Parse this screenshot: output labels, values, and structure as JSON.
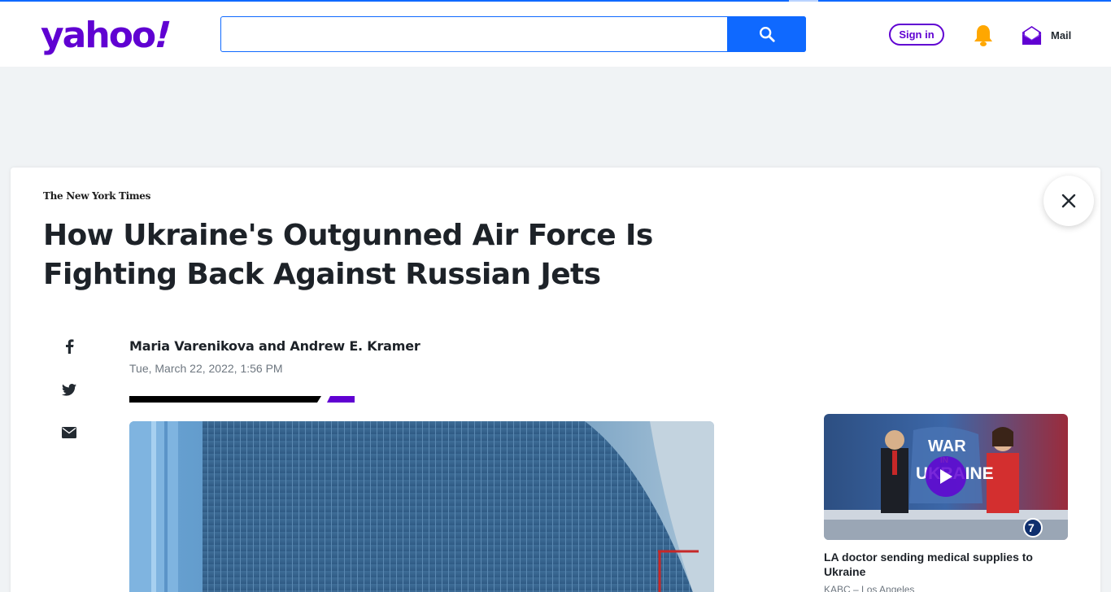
{
  "header": {
    "logo_text": "yahoo",
    "logo_bang": "!",
    "search_placeholder": "",
    "search_value": "",
    "sign_in_label": "Sign in",
    "mail_label": "Mail",
    "brand_color": "#6001d2",
    "accent_color": "#0f69ff"
  },
  "article": {
    "publisher": "The New York Times",
    "headline": "How Ukraine's Outgunned Air Force Is Fighting Back Against Russian Jets",
    "author": "Maria Varenikova and Andrew E. Kramer",
    "date": "Tue, March 22, 2022, 1:56 PM"
  },
  "share": {
    "items": [
      {
        "icon": "facebook-icon"
      },
      {
        "icon": "twitter-icon"
      },
      {
        "icon": "email-icon"
      }
    ]
  },
  "sidebar_video": {
    "overlay_line1": "WAR",
    "overlay_line2": "IN",
    "overlay_line3": "UKRAINE",
    "title": "LA doctor sending medical supplies to Ukraine",
    "source": "KABC – Los Angeles"
  }
}
